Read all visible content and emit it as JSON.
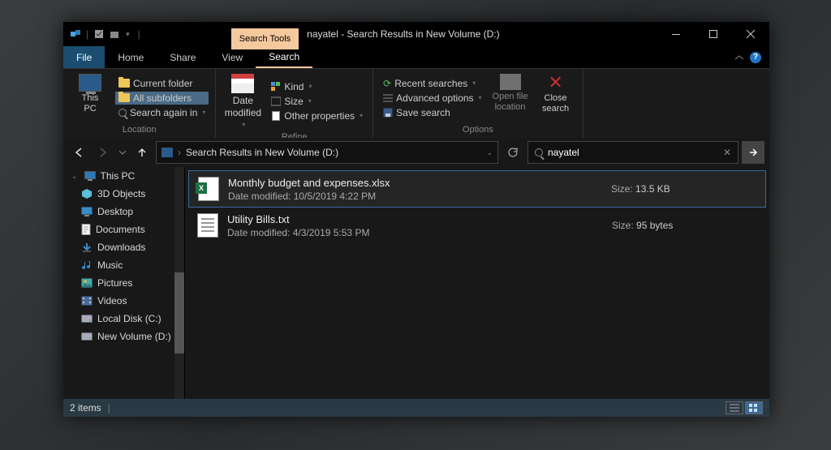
{
  "titlebar": {
    "searchToolsTab": "Search Tools",
    "title": "nayatel - Search Results in New Volume (D:)"
  },
  "menu": {
    "file": "File",
    "home": "Home",
    "share": "Share",
    "view": "View",
    "search": "Search"
  },
  "ribbon": {
    "thisPc": "This\nPC",
    "currentFolder": "Current folder",
    "allSubfolders": "All subfolders",
    "searchAgain": "Search again in",
    "locationGroup": "Location",
    "dateModified": "Date\nmodified",
    "kind": "Kind",
    "size": "Size",
    "otherProperties": "Other properties",
    "refineGroup": "Refine",
    "recentSearches": "Recent searches",
    "advancedOptions": "Advanced options",
    "saveSearch": "Save search",
    "openFileLocation": "Open file\nlocation",
    "closeSearch": "Close\nsearch",
    "optionsGroup": "Options"
  },
  "address": {
    "path": "Search Results in New Volume (D:)"
  },
  "search": {
    "value": "nayatel"
  },
  "sidebar": {
    "header": "This PC",
    "items": [
      {
        "label": "3D Objects",
        "icon": "cube"
      },
      {
        "label": "Desktop",
        "icon": "desktop"
      },
      {
        "label": "Documents",
        "icon": "doc"
      },
      {
        "label": "Downloads",
        "icon": "down"
      },
      {
        "label": "Music",
        "icon": "music"
      },
      {
        "label": "Pictures",
        "icon": "pic"
      },
      {
        "label": "Videos",
        "icon": "video"
      },
      {
        "label": "Local Disk (C:)",
        "icon": "disk"
      },
      {
        "label": "New Volume (D:)",
        "icon": "disk"
      }
    ]
  },
  "results": [
    {
      "name": "Monthly budget and expenses.xlsx",
      "modified": "Date modified: 10/5/2019 4:22 PM",
      "sizeLabel": "Size:",
      "size": "13.5 KB",
      "icon": "xlsx",
      "selected": true
    },
    {
      "name": "Utility Bills.txt",
      "modified": "Date modified: 4/3/2019 5:53 PM",
      "sizeLabel": "Size:",
      "size": "95 bytes",
      "icon": "txt",
      "selected": false
    }
  ],
  "status": {
    "count": "2 items"
  }
}
